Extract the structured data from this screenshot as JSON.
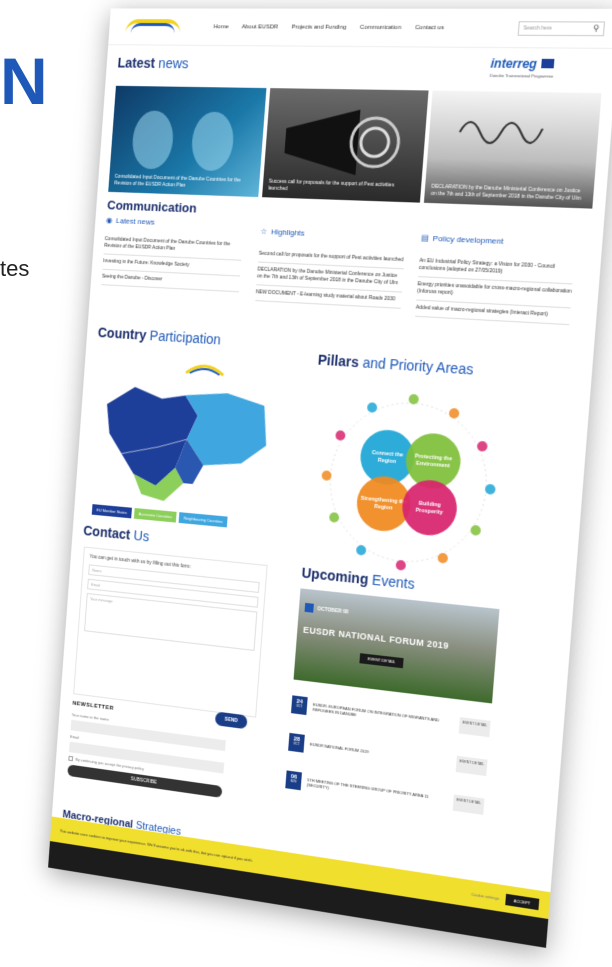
{
  "slide": {
    "letter": "N",
    "word": "tes"
  },
  "nav": {
    "items": [
      "Home",
      "About EUSDR",
      "Projects and Funding",
      "Communication",
      "Contact us"
    ],
    "search_placeholder": "Search here"
  },
  "interreg": {
    "name": "interreg",
    "sub": "Danube Transnational Programme"
  },
  "latest": {
    "title_bold": "Latest",
    "title_rest": " news"
  },
  "news": [
    {
      "caption": "Consolidated Input Document of the Danube Countries for the Revision of the EUSDR Action Plan"
    },
    {
      "caption": "Success call for proposals for the support of Pest activities launched"
    },
    {
      "caption": "DECLARATION by the Danube Ministerial Conference on Justice on the 7th and 13th of September 2018 in the Danube City of Ulm"
    }
  ],
  "communication": {
    "title": "Communication",
    "latest": "Latest news",
    "highlights": "Highlights",
    "policy": "Policy development",
    "latest_items": [
      "Consolidated Input Document of the Danube Countries for the Revision of the EUSDR Action Plan",
      "Investing in the Future: Knowledge Society",
      "Seeing the Danube - Discover"
    ],
    "highlight_items": [
      "Second call for proposals for the support of Pest activities launched",
      "DECLARATION by the Danube Ministerial Conference on Justice on the 7th and 13th of September 2018 in the Danube City of Ulm",
      "NEW DOCUMENT - E-learning study material about Roads 2030"
    ],
    "policy_items": [
      "An EU Industrial Policy Strategy: a Vision for 2030 - Council conclusions (adopted on 27/05/2019)",
      "Energy priorities unavoidable for cross-macro-regional collaboration (Inforuss report)",
      "Added value of macro-regional strategies (Interact Report)"
    ]
  },
  "country": {
    "title_bold": "Country",
    "title_rest": " Participation",
    "legend": [
      "EU Member States",
      "Accession Countries",
      "Neighbouring Countries"
    ]
  },
  "pillars": {
    "title_bold": "Pillars",
    "title_rest": " and Priority Areas",
    "labels": [
      "Connect the Region",
      "Protecting the Environment",
      "Strengthening the Region",
      "Building Prosperity"
    ],
    "colors": [
      "#1ea6d6",
      "#7fbf3a",
      "#f08a1f",
      "#d8246e"
    ]
  },
  "contact": {
    "title_bold": "Contact",
    "title_rest": " Us",
    "lead": "You can get in touch with us by filling out this form:",
    "name_ph": "Name",
    "email_ph": "Email",
    "message_ph": "Your message",
    "send": "SEND"
  },
  "newsletter": {
    "title": "NEWSLETTER",
    "name_label": "Your name or the name",
    "email_label": "Email",
    "consent": "By continuing you accept the privacy policy",
    "subscribe": "SUBSCRIBE"
  },
  "macro": {
    "title_bold": "Macro-regional",
    "title_rest": " Strategies"
  },
  "events": {
    "title_bold": "Upcoming",
    "title_rest": " Events",
    "hero_date": "OCTOBER 08",
    "hero_name": "EUSDR NATIONAL FORUM 2019",
    "hero_button": "EVENT DETAIL",
    "items": [
      {
        "day": "24",
        "month": "OCT",
        "text": "EUSDR: EUROPEAN FORUM ON INTEGRATION OF MIGRANTS AND REFUGEES IN DANUBE",
        "btn": "EVENT DETAIL"
      },
      {
        "day": "28",
        "month": "OCT",
        "text": "EUSDR NATIONAL FORUM 2019",
        "btn": "EVENT DETAIL"
      },
      {
        "day": "06",
        "month": "NOV",
        "text": "5TH MEETING OF THE STEERING GROUP OF PRIORITY AREA 11 (SECURITY)",
        "btn": "EVENT DETAIL"
      }
    ]
  },
  "cookie": {
    "text": "This website uses cookies to improve your experience. We'll assume you're ok with this, but you can opt-out if you wish.",
    "read_more": "Cookie settings",
    "accept": "ACCEPT"
  }
}
